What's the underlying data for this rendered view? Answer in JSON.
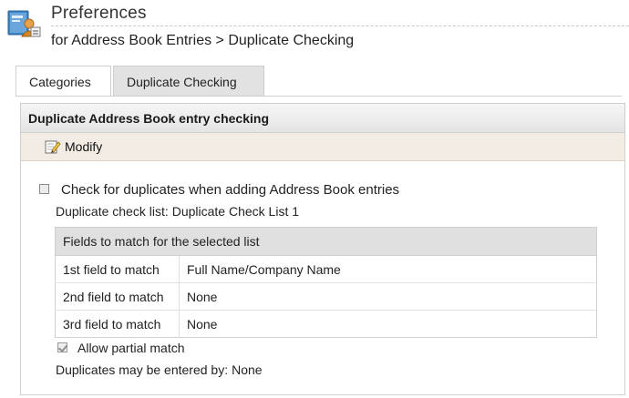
{
  "header": {
    "title": "Preferences",
    "subtitle": "for Address Book Entries > Duplicate Checking",
    "icon": "address-book-preferences-icon"
  },
  "tabs": [
    {
      "label": "Categories",
      "active": false
    },
    {
      "label": "Duplicate Checking",
      "active": true
    }
  ],
  "panel": {
    "title": "Duplicate Address Book entry checking",
    "modify_label": "Modify",
    "check_duplicates_label": "Check for duplicates when adding Address Book entries",
    "check_duplicates_checked": false,
    "duplicate_list_label": "Duplicate check list:",
    "duplicate_list_value": "Duplicate Check List 1",
    "fields_table": {
      "header": "Fields to match for the selected list",
      "rows": [
        {
          "label": "1st field to match",
          "value": "Full Name/Company Name"
        },
        {
          "label": "2nd field to match",
          "value": "None"
        },
        {
          "label": "3rd field to match",
          "value": "None"
        }
      ]
    },
    "partial_match_label": "Allow partial match",
    "partial_match_checked": true,
    "entered_by_label": "Duplicates may be entered by:",
    "entered_by_value": "None"
  }
}
